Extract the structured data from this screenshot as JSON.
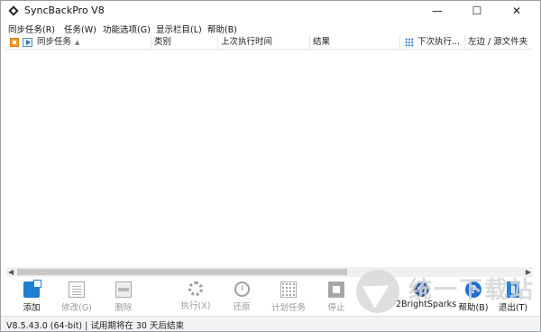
{
  "window": {
    "title": "SyncBackPro V8",
    "minimize_glyph": "—",
    "maximize_glyph": "☐",
    "close_glyph": "✕"
  },
  "menu": [
    {
      "label": "同步任务(R)"
    },
    {
      "label": "任务(W)"
    },
    {
      "label": "功能选项(G)"
    },
    {
      "label": "显示栏目(L)"
    },
    {
      "label": "帮助(B)"
    }
  ],
  "columns": {
    "name": "同步任务",
    "sort_glyph": "▲",
    "category": "类别",
    "last_run": "上次执行时间",
    "result": "结果",
    "next_run": "下次执行...",
    "source": "左边 / 源文件夹"
  },
  "toolbar": [
    {
      "label": "添加",
      "icon": "add-profile-icon",
      "enabled": true
    },
    {
      "label": "修改(G)",
      "icon": "edit-profile-icon",
      "enabled": false
    },
    {
      "label": "删除",
      "icon": "delete-profile-icon",
      "enabled": false
    },
    {
      "label": "执行(X)",
      "icon": "run-gear-icon",
      "enabled": false
    },
    {
      "label": "还原",
      "icon": "restore-clock-icon",
      "enabled": false
    },
    {
      "label": "计划任务",
      "icon": "schedule-calendar-icon",
      "enabled": false
    },
    {
      "label": "停止",
      "icon": "stop-icon",
      "enabled": false
    },
    {
      "label": "2BrightSparks",
      "icon": "2brightsparks-logo-icon",
      "enabled": true
    },
    {
      "label": "帮助(B)",
      "icon": "help-icon",
      "enabled": true,
      "glyph": "?"
    },
    {
      "label": "退出(T)",
      "icon": "exit-door-icon",
      "enabled": true
    }
  ],
  "watermark": {
    "text": "统一下载站"
  },
  "status": {
    "text": "V8.5.43.0 (64-bit) | 试用期将在 30 天后结束"
  },
  "colors": {
    "accent_blue": "#1f7fd0",
    "header_orange": "#f59a23",
    "disabled_text": "#9a9a9a"
  }
}
